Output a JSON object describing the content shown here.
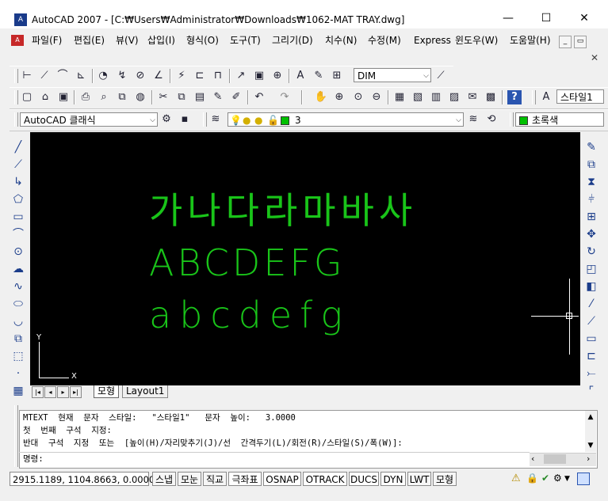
{
  "window": {
    "title": "AutoCAD 2007 - [C:₩Users₩Administrator₩Downloads₩1062-MAT TRAY.dwg]",
    "app_icon_label": "A",
    "minimize_glyph": "—",
    "maximize_glyph": "☐",
    "close_glyph": "✕"
  },
  "menu": {
    "items": [
      "파일(F)",
      "편집(E)",
      "뷰(V)",
      "삽입(I)",
      "형식(O)",
      "도구(T)",
      "그리기(D)",
      "치수(N)",
      "수정(M)",
      "Express",
      "윈도우(W)",
      "도움말(H)"
    ],
    "mdi_minimize": "_",
    "mdi_restore": "▭",
    "mdi_close": "✕"
  },
  "toolbars": {
    "dimstyle_combo": "DIM",
    "textstyle_combo": "스타일1",
    "workspace_combo": "AutoCAD 클래식",
    "layer_combo": "3",
    "color_combo": "초록색",
    "layer_color": "#00c000"
  },
  "canvas": {
    "line1": "가나다라마바사",
    "line2": "ABCDEFG",
    "line3": "abcdefg",
    "text_color": "#19c419",
    "ucs_y": "Y",
    "ucs_x": "X"
  },
  "layout_tabs": {
    "model": "모형",
    "layout1": "Layout1"
  },
  "command": {
    "line1": "MTEXT  현재  문자  스타일:   \"스타일1\"   문자  높이:   3.0000",
    "line2": "첫  번째  구석  지정:",
    "line3": "반대  구석  지정  또는  [높이(H)/자리맞추기(J)/선  간격두기(L)/회전(R)/스타일(S)/폭(W)]:",
    "prompt": "명령:"
  },
  "status": {
    "coordinates": "2915.1189, 1104.8663, 0.0000",
    "buttons": [
      "스냅",
      "모눈",
      "직교",
      "극좌표",
      "OSNAP",
      "OTRACK",
      "DUCS",
      "DYN",
      "LWT",
      "모형"
    ]
  }
}
